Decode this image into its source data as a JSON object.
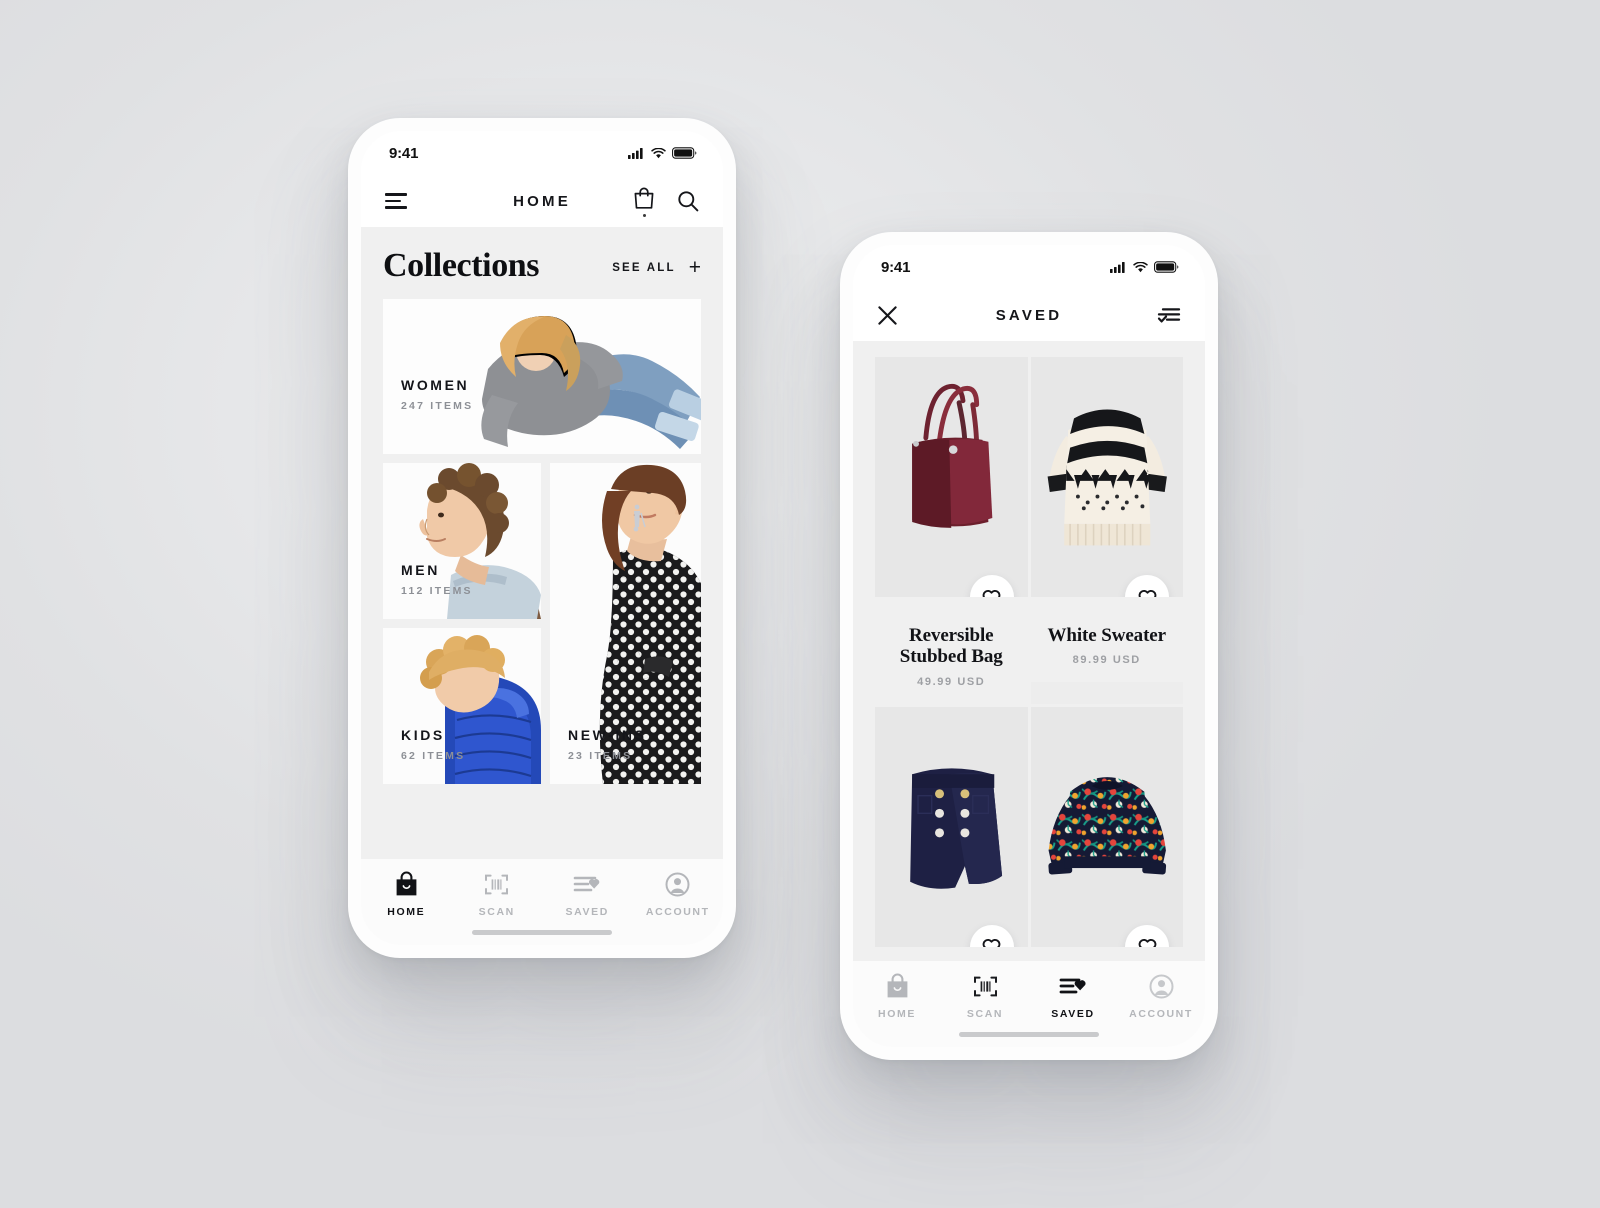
{
  "background": {
    "color": "#e1e2e4"
  },
  "phone_home": {
    "status": {
      "time": "9:41",
      "signal_icon": "cellular-signal-icon",
      "wifi_icon": "wifi-icon",
      "battery_icon": "battery-icon"
    },
    "navbar": {
      "menu_icon": "hamburger-menu-icon",
      "title": "HOME",
      "bag_icon": "shopping-bag-icon",
      "search_icon": "search-icon"
    },
    "section": {
      "title": "Collections",
      "see_all_label": "SEE ALL",
      "plus_label": "+"
    },
    "collections": [
      {
        "name": "WOMEN",
        "count": "247 ITEMS",
        "layout": "wide"
      },
      {
        "name": "MEN",
        "count": "112 ITEMS",
        "layout": "square"
      },
      {
        "name": "KIDS",
        "count": "62 ITEMS",
        "layout": "square"
      },
      {
        "name": "NEW-INS",
        "count": "23 ITEMS",
        "layout": "tall"
      }
    ],
    "tabs": [
      {
        "label": "HOME",
        "icon": "shopping-bag-icon",
        "active": true
      },
      {
        "label": "SCAN",
        "icon": "barcode-scan-icon",
        "active": false
      },
      {
        "label": "SAVED",
        "icon": "saved-list-heart-icon",
        "active": false
      },
      {
        "label": "ACCOUNT",
        "icon": "user-account-icon",
        "active": false
      }
    ]
  },
  "phone_saved": {
    "status": {
      "time": "9:41",
      "signal_icon": "cellular-signal-icon",
      "wifi_icon": "wifi-icon",
      "battery_icon": "battery-icon"
    },
    "navbar": {
      "close_icon": "close-x-icon",
      "title": "SAVED",
      "filter_icon": "filter-sort-icon"
    },
    "products": [
      {
        "name": "Reversible\nStubbed Bag",
        "name_line1": "Reversible",
        "name_line2": "Stubbed Bag",
        "price": "49.99 USD",
        "image": "burgundy-tote-bag",
        "heart_icon": "heart-icon"
      },
      {
        "name": "White Sweater",
        "name_line1": "White Sweater",
        "name_line2": "",
        "price": "89.99 USD",
        "image": "fair-isle-white-sweater",
        "heart_icon": "heart-icon"
      },
      {
        "name": "",
        "name_line1": "",
        "name_line2": "",
        "price": "",
        "image": "navy-button-skort",
        "heart_icon": "heart-icon"
      },
      {
        "name": "",
        "name_line1": "",
        "name_line2": "",
        "price": "",
        "image": "floral-print-sweater",
        "heart_icon": "heart-icon"
      }
    ],
    "tabs": [
      {
        "label": "HOME",
        "icon": "shopping-bag-icon",
        "active": false
      },
      {
        "label": "SCAN",
        "icon": "barcode-scan-icon",
        "active": false
      },
      {
        "label": "SAVED",
        "icon": "saved-list-heart-icon",
        "active": true
      },
      {
        "label": "ACCOUNT",
        "icon": "user-account-icon",
        "active": false
      }
    ]
  }
}
